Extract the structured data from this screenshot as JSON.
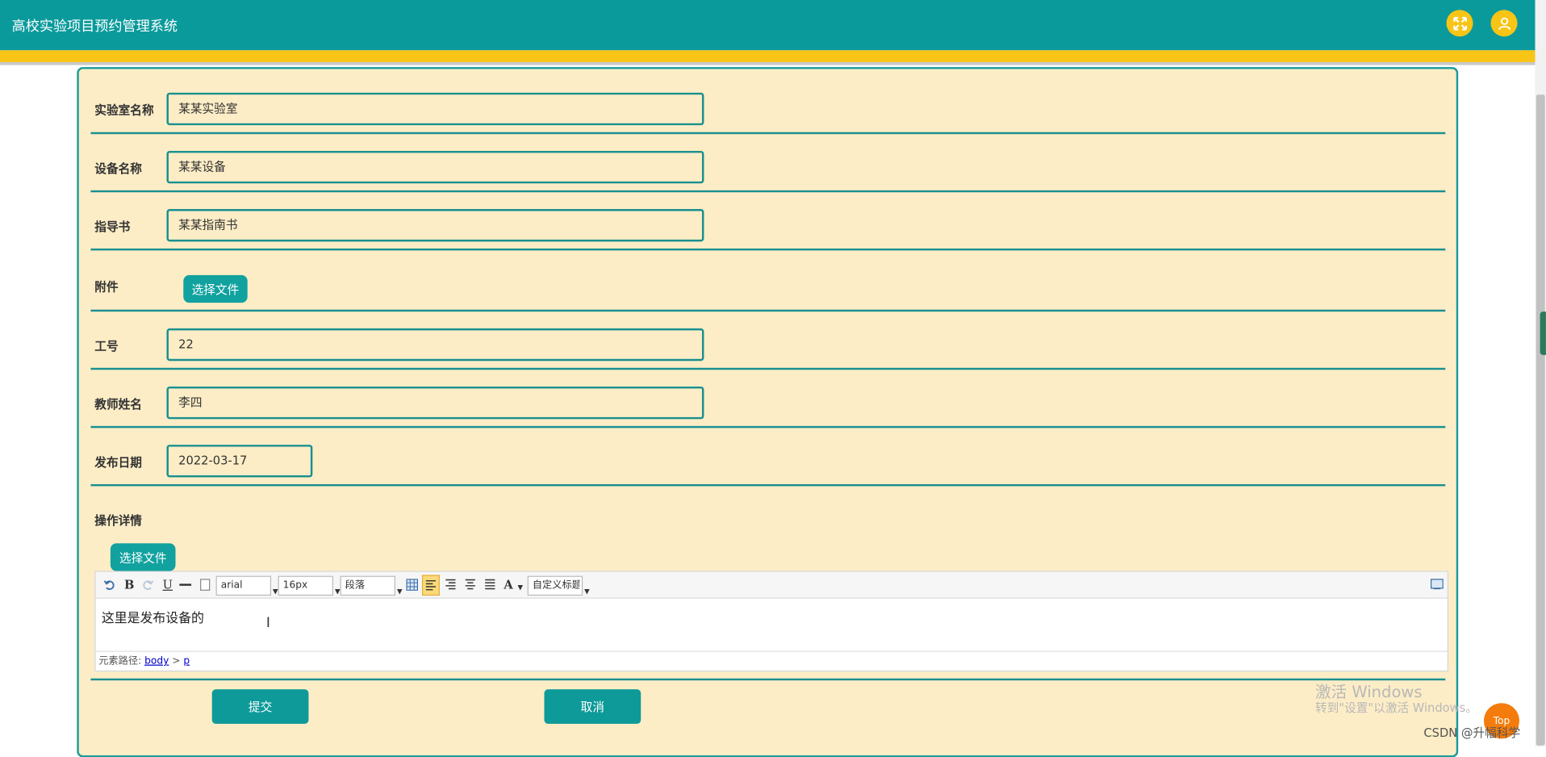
{
  "app": {
    "title": "高校实验项目预约管理系统"
  },
  "header": {
    "fullscreen_icon": "expand-icon",
    "user_icon": "user-icon",
    "accent": "#0b9a9c",
    "highlight": "#f8c416"
  },
  "form": {
    "lab_name": {
      "label": "实验室名称",
      "value": "某某实验室"
    },
    "device_name": {
      "label": "设备名称",
      "value": "某某设备"
    },
    "guide": {
      "label": "指导书",
      "value": "某某指南书"
    },
    "attachment": {
      "label": "附件",
      "button": "选择文件"
    },
    "staff_id": {
      "label": "工号",
      "value": "22"
    },
    "teacher_name": {
      "label": "教师姓名",
      "value": "李四"
    },
    "publish_date": {
      "label": "发布日期",
      "value": "2022-03-17"
    },
    "details": {
      "label": "操作详情",
      "button": "选择文件"
    }
  },
  "editor": {
    "toolbar": {
      "bold": "B",
      "underline": "U",
      "font_color": "A",
      "font_family": "arial",
      "font_size": "16px",
      "paragraph": "段落",
      "custom_heading": "自定义标题"
    },
    "content": "这里是发布设备的",
    "path_label": "元素路径:",
    "path_body": "body",
    "path_sep": ">",
    "path_p": "p"
  },
  "actions": {
    "submit": "提交",
    "cancel": "取消"
  },
  "overlay": {
    "watermark_title": "激活 Windows",
    "watermark_sub": "转到\"设置\"以激活 Windows。",
    "csdn": "CSDN @升幅科学",
    "top": "Top"
  }
}
